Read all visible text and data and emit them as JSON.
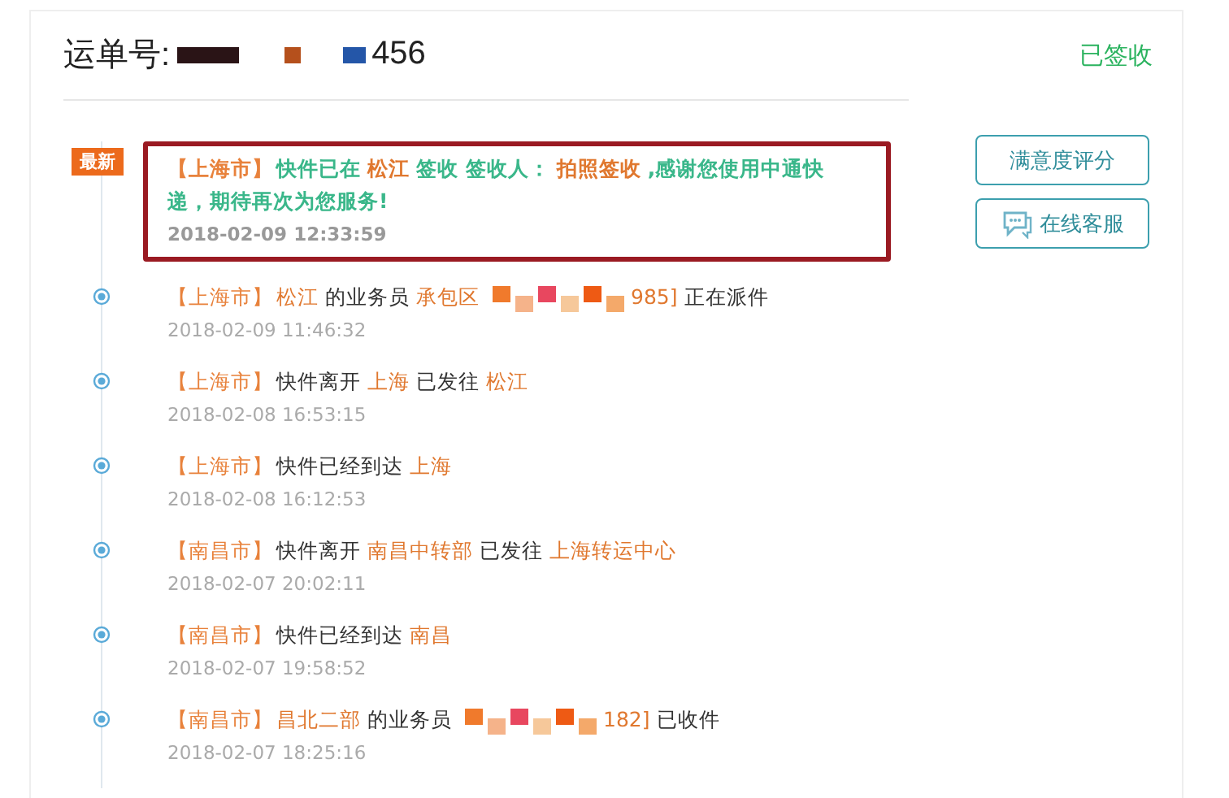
{
  "header": {
    "label": "运单号:",
    "number_tail": "456",
    "status": "已签收"
  },
  "latest_badge": "最新",
  "buttons": [
    {
      "label": "满意度评分",
      "icon": false
    },
    {
      "label": "在线客服",
      "icon": true
    }
  ],
  "events": [
    {
      "latest": true,
      "segments": [
        {
          "kind": "city",
          "text": "【上海市】"
        },
        {
          "kind": "plain",
          "text": "快件已在"
        },
        {
          "kind": "place",
          "text": "松江"
        },
        {
          "kind": "plain",
          "text": "签收 签收人："
        },
        {
          "kind": "place",
          "text": "拍照签收"
        },
        {
          "kind": "plain",
          "text": ",感谢您使用中通快递，期待再次为您服务!"
        }
      ],
      "time": "2018-02-09 12:33:59"
    },
    {
      "latest": false,
      "segments": [
        {
          "kind": "city",
          "text": "【上海市】"
        },
        {
          "kind": "place",
          "text": "松江"
        },
        {
          "kind": "plain",
          "text": "的业务员"
        },
        {
          "kind": "place",
          "text": "承包区"
        },
        {
          "kind": "redacted"
        },
        {
          "kind": "place",
          "text": "985]"
        },
        {
          "kind": "plain",
          "text": "正在派件"
        }
      ],
      "time": "2018-02-09 11:46:32"
    },
    {
      "latest": false,
      "segments": [
        {
          "kind": "city",
          "text": "【上海市】"
        },
        {
          "kind": "plain",
          "text": "快件离开"
        },
        {
          "kind": "place",
          "text": "上海"
        },
        {
          "kind": "plain",
          "text": "已发往"
        },
        {
          "kind": "place",
          "text": "松江"
        }
      ],
      "time": "2018-02-08 16:53:15"
    },
    {
      "latest": false,
      "segments": [
        {
          "kind": "city",
          "text": "【上海市】"
        },
        {
          "kind": "plain",
          "text": "快件已经到达"
        },
        {
          "kind": "place",
          "text": "上海"
        }
      ],
      "time": "2018-02-08 16:12:53"
    },
    {
      "latest": false,
      "segments": [
        {
          "kind": "city",
          "text": "【南昌市】"
        },
        {
          "kind": "plain",
          "text": "快件离开"
        },
        {
          "kind": "place",
          "text": "南昌中转部"
        },
        {
          "kind": "plain",
          "text": "已发往"
        },
        {
          "kind": "place",
          "text": "上海转运中心"
        }
      ],
      "time": "2018-02-07 20:02:11"
    },
    {
      "latest": false,
      "segments": [
        {
          "kind": "city",
          "text": "【南昌市】"
        },
        {
          "kind": "plain",
          "text": "快件已经到达"
        },
        {
          "kind": "place",
          "text": "南昌"
        }
      ],
      "time": "2018-02-07 19:58:52"
    },
    {
      "latest": false,
      "segments": [
        {
          "kind": "city",
          "text": "【南昌市】"
        },
        {
          "kind": "place",
          "text": "昌北二部"
        },
        {
          "kind": "plain",
          "text": "的业务员"
        },
        {
          "kind": "redacted"
        },
        {
          "kind": "place",
          "text": "182]"
        },
        {
          "kind": "plain",
          "text": "已收件"
        }
      ],
      "time": "2018-02-07 18:25:16"
    }
  ]
}
